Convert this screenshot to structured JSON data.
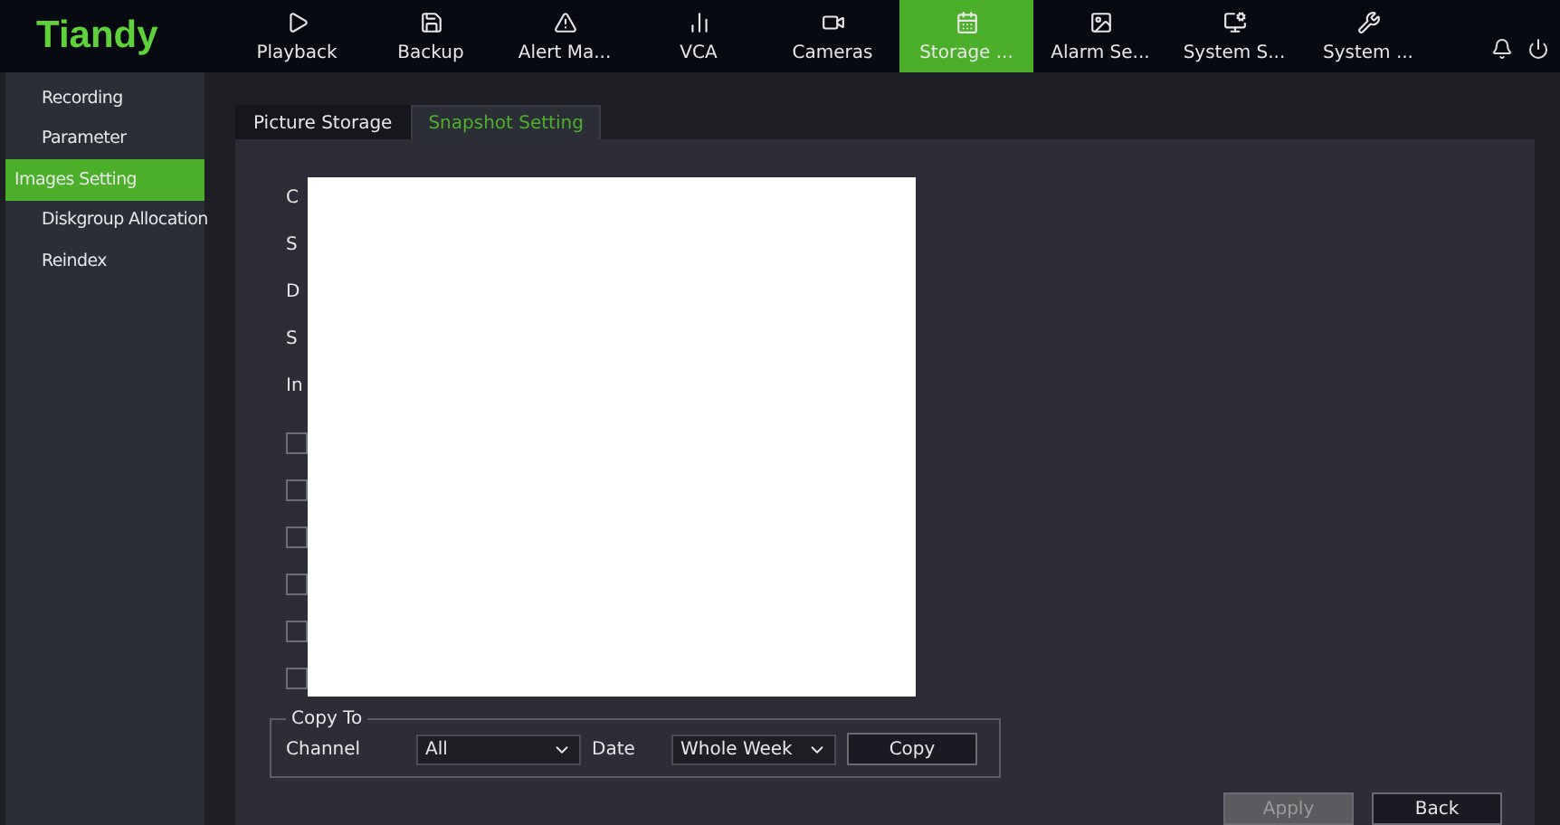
{
  "logo": "Tiandy",
  "nav": [
    {
      "label": "Playback",
      "selected": false
    },
    {
      "label": "Backup",
      "selected": false
    },
    {
      "label": "Alert Ma...",
      "selected": false
    },
    {
      "label": "VCA",
      "selected": false
    },
    {
      "label": "Cameras",
      "selected": false
    },
    {
      "label": "Storage ...",
      "selected": true
    },
    {
      "label": "Alarm Se...",
      "selected": false
    },
    {
      "label": "System S...",
      "selected": false
    },
    {
      "label": "System ...",
      "selected": false
    }
  ],
  "sidebar": {
    "items": [
      {
        "label": "Recording",
        "selected": false
      },
      {
        "label": "Parameter",
        "selected": false
      },
      {
        "label": "Images Setting",
        "selected": true
      },
      {
        "label": "Diskgroup Allocation",
        "selected": false
      },
      {
        "label": "Reindex",
        "selected": false
      }
    ]
  },
  "tabs": [
    {
      "label": "Picture Storage",
      "selected": false
    },
    {
      "label": "Snapshot Setting",
      "selected": true
    }
  ],
  "form": {
    "labels": [
      "C",
      "S",
      "D",
      "S",
      "In"
    ],
    "checkboxes": [
      {
        "checked": false
      },
      {
        "checked": false
      },
      {
        "checked": false
      },
      {
        "checked": false
      },
      {
        "checked": false
      },
      {
        "checked": false
      }
    ]
  },
  "copy_to": {
    "title": "Copy To",
    "channel_label": "Channel",
    "channel": "All",
    "date_label": "Date",
    "date": "Whole Week",
    "copy_button": "Copy"
  },
  "buttons": [
    {
      "label": "Apply",
      "disabled": true
    },
    {
      "label": "Back",
      "disabled": false
    }
  ],
  "cover": {
    "kind": "blank"
  }
}
